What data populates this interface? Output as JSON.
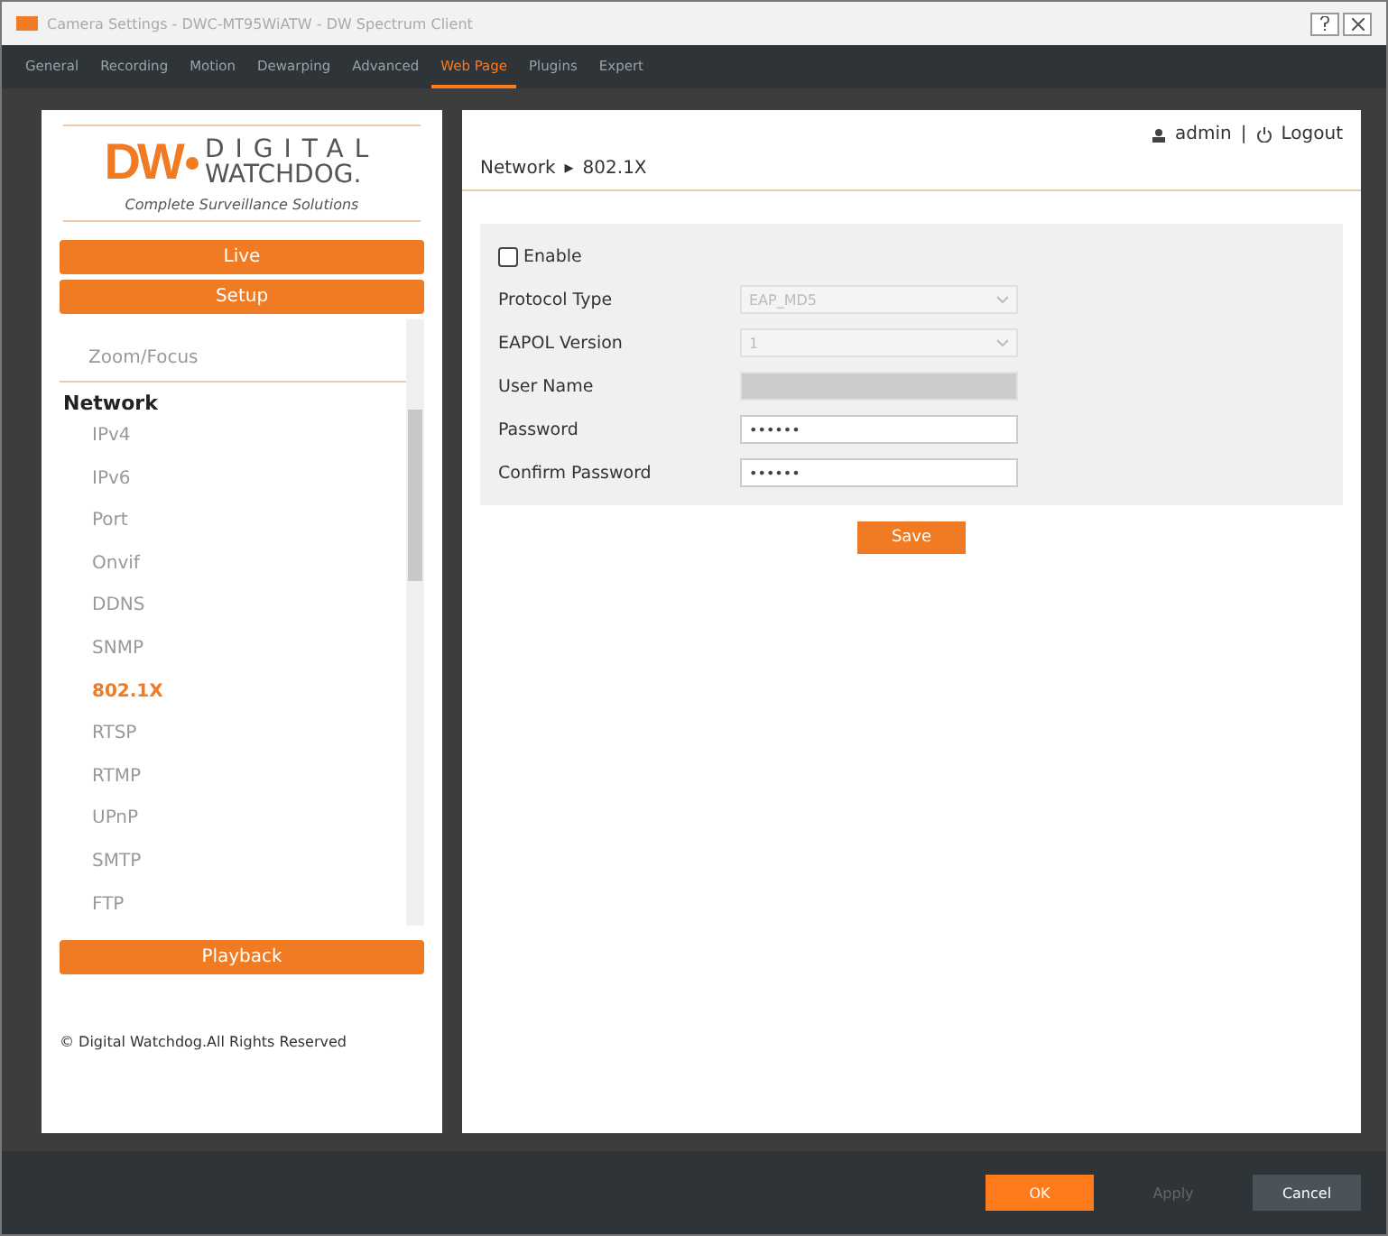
{
  "window": {
    "title": "Camera Settings - DWC-MT95WiATW - DW Spectrum Client"
  },
  "tabs": [
    {
      "label": "General",
      "selected": false
    },
    {
      "label": "Recording",
      "selected": false
    },
    {
      "label": "Motion",
      "selected": false
    },
    {
      "label": "Dewarping",
      "selected": false
    },
    {
      "label": "Advanced",
      "selected": false
    },
    {
      "label": "Web Page",
      "selected": true
    },
    {
      "label": "Plugins",
      "selected": false
    },
    {
      "label": "Expert",
      "selected": false
    }
  ],
  "logo": {
    "mark": "DW",
    "line1": "DIGITAL",
    "line2": "WATCHDOG.",
    "tagline": "Complete Surveillance Solutions"
  },
  "nav_buttons": [
    "Live",
    "Setup"
  ],
  "menu": {
    "items_before": [
      "Zoom/Focus"
    ],
    "section": "Network",
    "items": [
      {
        "label": "IPv4",
        "selected": false
      },
      {
        "label": "IPv6",
        "selected": false
      },
      {
        "label": "Port",
        "selected": false
      },
      {
        "label": "Onvif",
        "selected": false
      },
      {
        "label": "DDNS",
        "selected": false
      },
      {
        "label": "SNMP",
        "selected": false
      },
      {
        "label": "802.1X",
        "selected": true
      },
      {
        "label": "RTSP",
        "selected": false
      },
      {
        "label": "RTMP",
        "selected": false
      },
      {
        "label": "UPnP",
        "selected": false
      },
      {
        "label": "SMTP",
        "selected": false
      },
      {
        "label": "FTP",
        "selected": false
      }
    ]
  },
  "playback_button": "Playback",
  "copyright": "© Digital Watchdog.All Rights Reserved",
  "user": {
    "name": "admin",
    "separator": "|",
    "logout": "Logout"
  },
  "breadcrumb": {
    "parent": "Network",
    "arrow": "▸",
    "current": "802.1X"
  },
  "form": {
    "enable": {
      "label": "Enable",
      "checked": false
    },
    "fields": [
      {
        "kind": "select",
        "label": "Protocol Type",
        "value": "EAP_MD5"
      },
      {
        "kind": "select",
        "label": "EAPOL Version",
        "value": "1"
      },
      {
        "kind": "disabled",
        "label": "User Name"
      },
      {
        "kind": "password",
        "label": "Password",
        "value": "••••••"
      },
      {
        "kind": "password",
        "label": "Confirm Password",
        "value": "••••••"
      }
    ],
    "save": "Save"
  },
  "footer_buttons": [
    {
      "label": "OK",
      "kind": "primary"
    },
    {
      "label": "Apply",
      "kind": "disabled"
    },
    {
      "label": "Cancel",
      "kind": "normal"
    }
  ]
}
